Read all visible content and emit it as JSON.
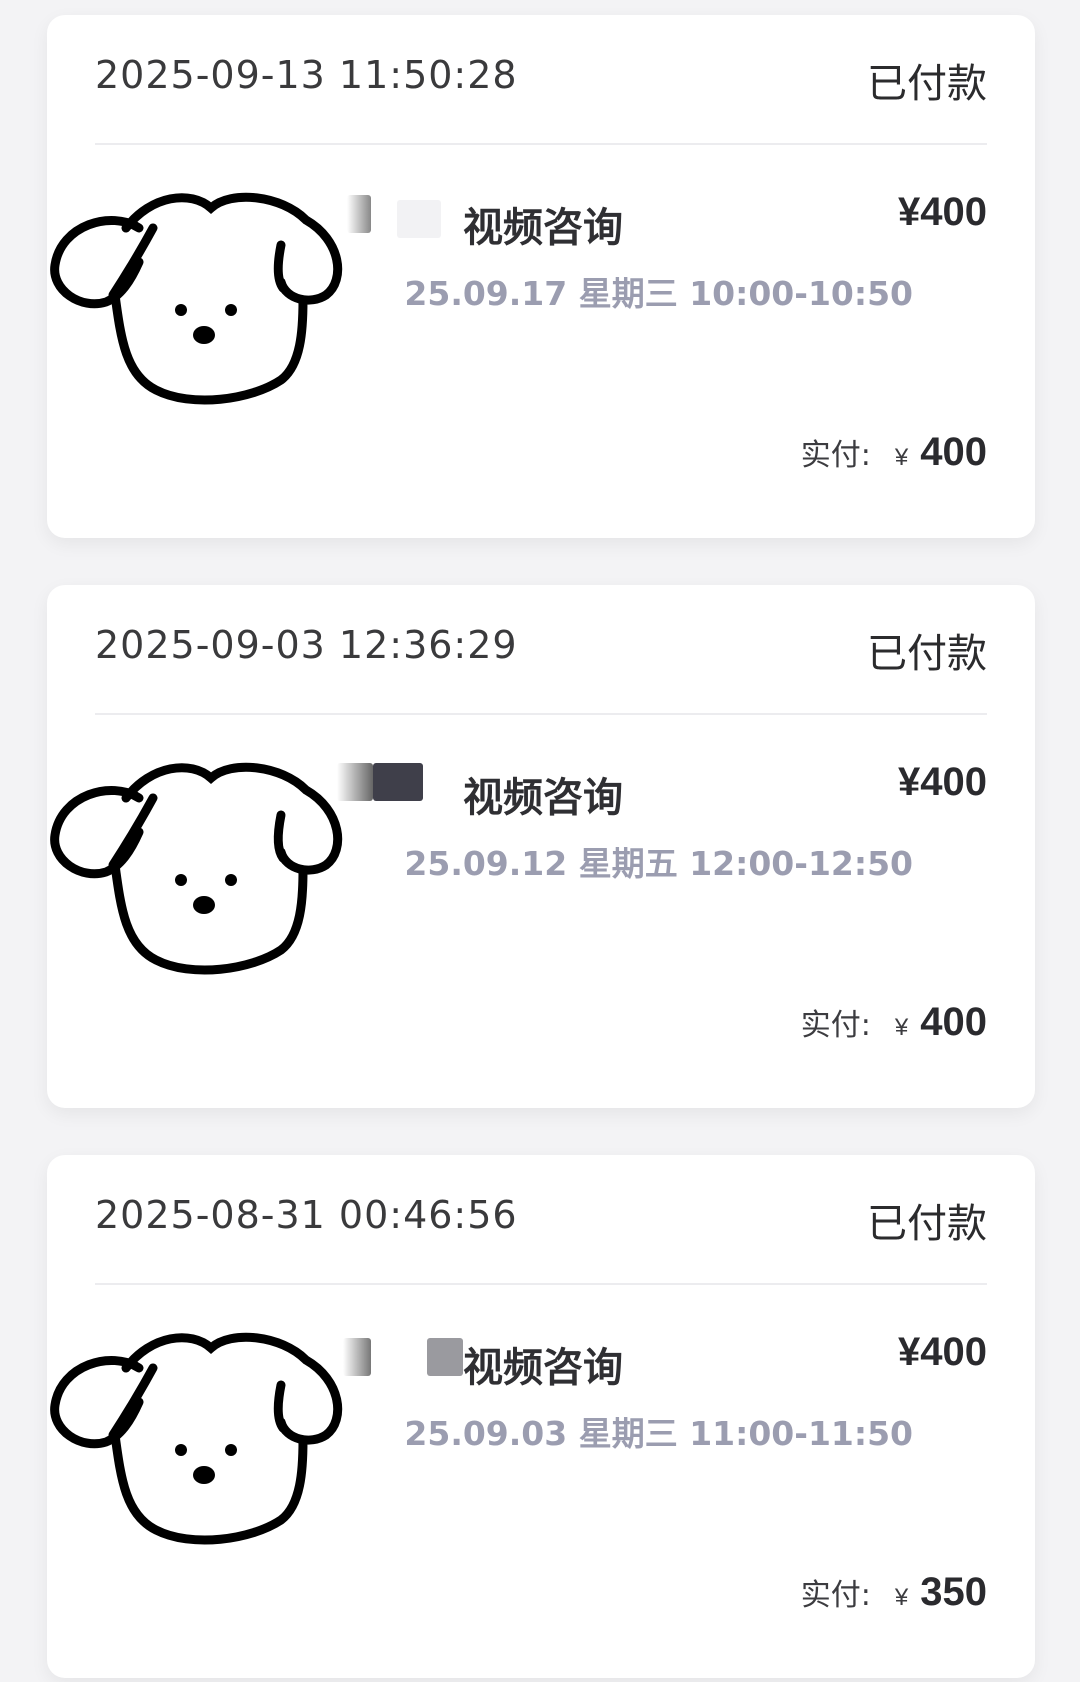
{
  "orders": [
    {
      "order_time": "2025-09-13 11:50:28",
      "status": "已付款",
      "avatar_icon": "dog-face-avatar-icon",
      "service": "视频咨询",
      "price": "¥400",
      "schedule": "25.09.17 星期三 10:00-10:50",
      "paid_label": "实付:",
      "currency": "¥",
      "paid_amount": "400"
    },
    {
      "order_time": "2025-09-03 12:36:29",
      "status": "已付款",
      "avatar_icon": "dog-face-avatar-icon",
      "service": "视频咨询",
      "price": "¥400",
      "schedule": "25.09.12 星期五 12:00-12:50",
      "paid_label": "实付:",
      "currency": "¥",
      "paid_amount": "400"
    },
    {
      "order_time": "2025-08-31 00:46:56",
      "status": "已付款",
      "avatar_icon": "dog-face-avatar-icon",
      "service": "视频咨询",
      "price": "¥400",
      "schedule": "25.09.03 星期三 11:00-11:50",
      "paid_label": "实付:",
      "currency": "¥",
      "paid_amount": "350"
    }
  ],
  "colors": {
    "background": "#f3f3f5",
    "card": "#ffffff",
    "schedule_text": "#9b9db0",
    "primary_text": "#2a2a2e"
  }
}
